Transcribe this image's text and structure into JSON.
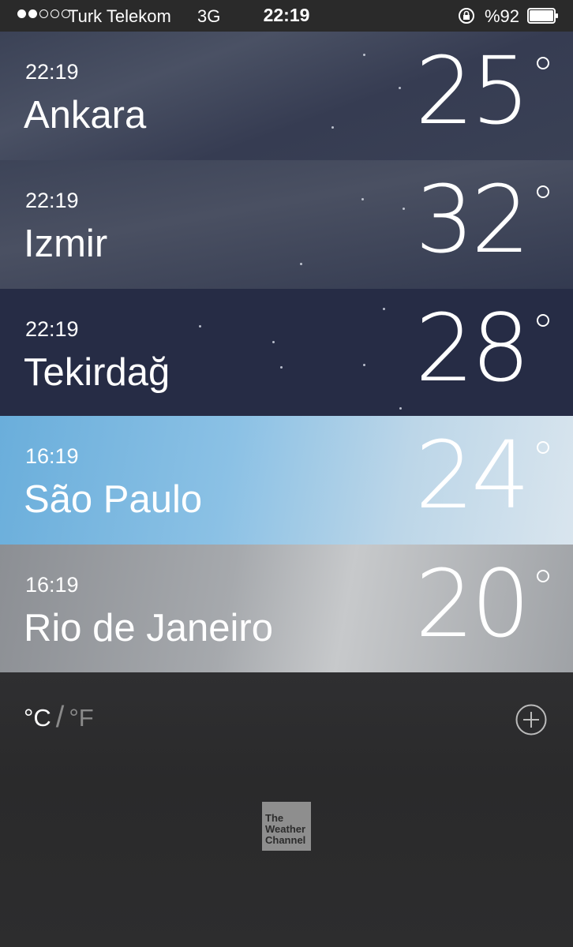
{
  "status_bar": {
    "signal_strength": 2,
    "signal_max": 5,
    "carrier": "Turk Telekom",
    "network": "3G",
    "time": "22:19",
    "battery": "%92",
    "battery_level": 0.92
  },
  "cities": [
    {
      "time": "22:19",
      "name": "Ankara",
      "temp": "25"
    },
    {
      "time": "22:19",
      "name": "Izmir",
      "temp": "32"
    },
    {
      "time": "22:19",
      "name": "Tekirdağ",
      "temp": "28"
    },
    {
      "time": "16:19",
      "name": "São Paulo",
      "temp": "24"
    },
    {
      "time": "16:19",
      "name": "Rio de Janeiro",
      "temp": "20"
    }
  ],
  "footer": {
    "unit_c": "°C",
    "unit_separator": "/",
    "unit_f": "°F",
    "logo": {
      "line1": "The",
      "line2": "Weather",
      "line3": "Channel"
    }
  }
}
